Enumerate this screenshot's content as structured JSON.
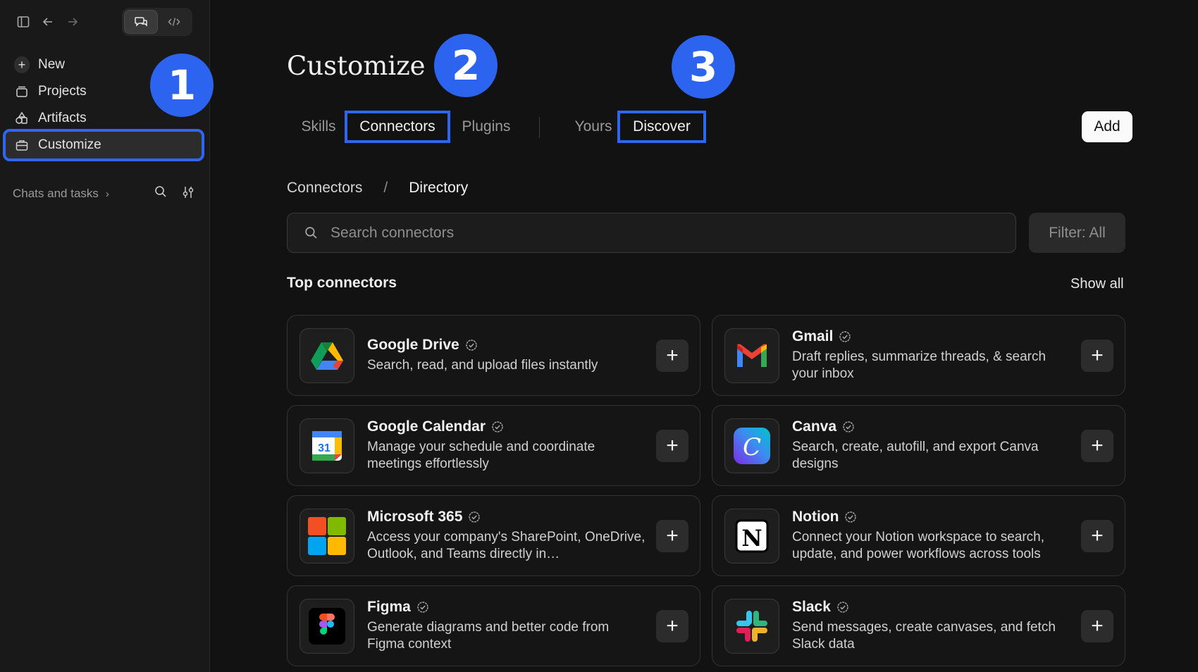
{
  "sidebar": {
    "mode_toggle": [
      "chat",
      "code"
    ],
    "nav": [
      {
        "label": "New",
        "icon": "plus-icon"
      },
      {
        "label": "Projects",
        "icon": "projects-icon"
      },
      {
        "label": "Artifacts",
        "icon": "artifacts-icon"
      },
      {
        "label": "Customize",
        "icon": "briefcase-icon",
        "active": true
      }
    ],
    "section_label": "Chats and tasks"
  },
  "badges": [
    "1",
    "2",
    "3"
  ],
  "main": {
    "title": "Customize",
    "tabs": [
      "Skills",
      "Connectors",
      "Plugins",
      "Yours",
      "Discover"
    ],
    "selected_tabs": [
      "Connectors",
      "Discover"
    ],
    "add_label": "Add",
    "breadcrumb": {
      "root": "Connectors",
      "sep": "/",
      "current": "Directory"
    },
    "search": {
      "placeholder": "Search connectors"
    },
    "filter_label": "Filter: All",
    "section_title": "Top connectors",
    "show_all": "Show all",
    "connectors": [
      {
        "name": "Google Drive",
        "desc": "Search, read, and upload files instantly",
        "icon": "google-drive-icon"
      },
      {
        "name": "Gmail",
        "desc": "Draft replies, summarize threads, & search your inbox",
        "icon": "gmail-icon"
      },
      {
        "name": "Google Calendar",
        "desc": "Manage your schedule and coordinate meetings effortlessly",
        "icon": "google-calendar-icon"
      },
      {
        "name": "Canva",
        "desc": "Search, create, autofill, and export Canva designs",
        "icon": "canva-icon"
      },
      {
        "name": "Microsoft 365",
        "desc": "Access your company's SharePoint, OneDrive, Outlook, and Teams directly in…",
        "icon": "microsoft-365-icon"
      },
      {
        "name": "Notion",
        "desc": "Connect your Notion workspace to search, update, and power workflows across tools",
        "icon": "notion-icon"
      },
      {
        "name": "Figma",
        "desc": "Generate diagrams and better code from Figma context",
        "icon": "figma-icon"
      },
      {
        "name": "Slack",
        "desc": "Send messages, create canvases, and fetch Slack data",
        "icon": "slack-icon"
      }
    ],
    "calendar_day": "31",
    "canva_letter": "C",
    "notion_letter": "N"
  },
  "colors": {
    "accent_outline": "#2f66f0",
    "badge": "#2c63ef",
    "background": "#121212"
  }
}
